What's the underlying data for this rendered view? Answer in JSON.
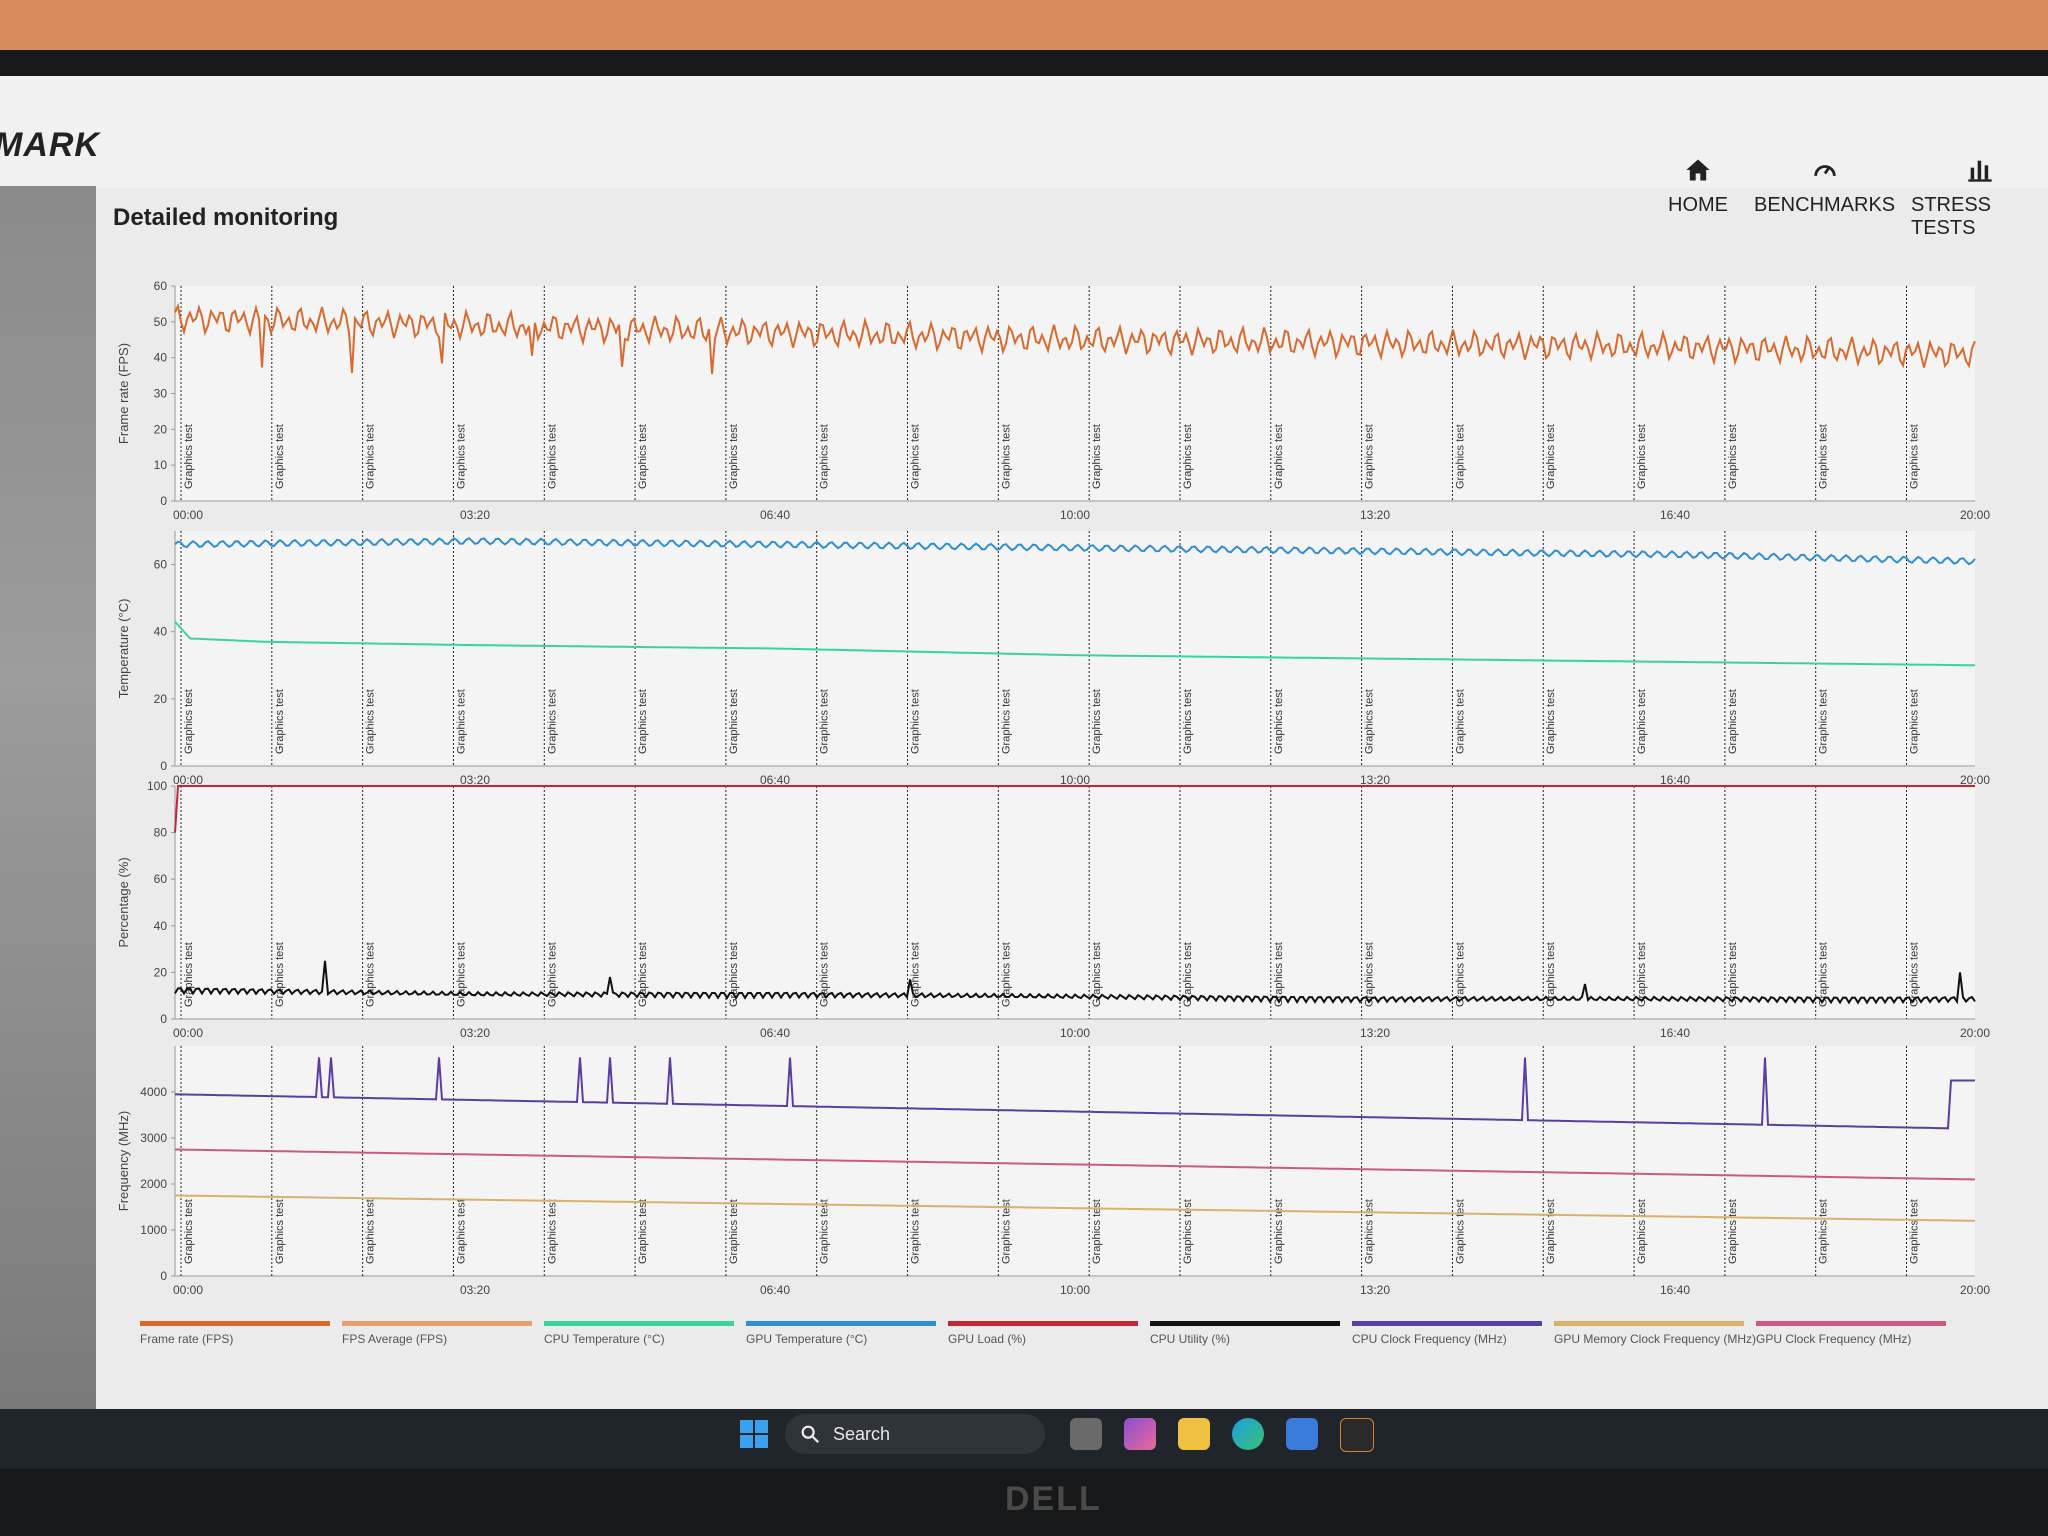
{
  "app": {
    "logo": "MARK"
  },
  "nav": [
    {
      "label": "HOME",
      "icon": "home-icon"
    },
    {
      "label": "BENCHMARKS",
      "icon": "gauge-icon"
    },
    {
      "label": "STRESS TESTS",
      "icon": "bar-chart-icon"
    }
  ],
  "page": {
    "title": "Detailed monitoring"
  },
  "taskbar": {
    "search_placeholder": "Search"
  },
  "monitor_brand": "DELL",
  "colors": {
    "frame_rate": "#d86a30",
    "fps_average": "#e5a070",
    "cpu_temp": "#3ad39a",
    "gpu_temp": "#2f8fd0",
    "gpu_load": "#c0283a",
    "cpu_utility": "#111111",
    "cpu_clock": "#5a3fa0",
    "gpu_mem_clock": "#d8b070",
    "gpu_clock": "#c85a86"
  },
  "chart_data": [
    {
      "type": "line",
      "ylabel": "Frame rate (FPS)",
      "ylim": [
        0,
        60
      ],
      "yticks": [
        0,
        10,
        20,
        30,
        40,
        50,
        60
      ],
      "x_ticks": [
        "00:00",
        "03:20",
        "06:40",
        "10:00",
        "13:20",
        "16:40",
        "20:00"
      ],
      "marker_label": "Graphics test",
      "series": [
        {
          "name": "Frame rate (FPS)",
          "x": [
            0,
            200,
            400,
            600,
            800,
            1000,
            1200
          ],
          "y": [
            51,
            49,
            47,
            45,
            44,
            43,
            41
          ]
        }
      ]
    },
    {
      "type": "line",
      "ylabel": "Temperature (°C)",
      "ylim": [
        0,
        70
      ],
      "yticks": [
        0,
        20,
        40,
        60
      ],
      "x_ticks": [
        "00:00",
        "03:20",
        "06:40",
        "10:00",
        "13:20",
        "16:40",
        "20:00"
      ],
      "marker_label": "Graphics test",
      "series": [
        {
          "name": "GPU Temperature (°C)",
          "x": [
            0,
            200,
            400,
            600,
            800,
            1000,
            1200
          ],
          "y": [
            66,
            67,
            66,
            65,
            64,
            63,
            61
          ]
        },
        {
          "name": "CPU Temperature (°C)",
          "x": [
            0,
            10,
            60,
            200,
            400,
            600,
            800,
            1000,
            1200
          ],
          "y": [
            43,
            38,
            37,
            36,
            35,
            33,
            32,
            31,
            30
          ]
        }
      ]
    },
    {
      "type": "line",
      "ylabel": "Percentage (%)",
      "ylim": [
        0,
        100
      ],
      "yticks": [
        0,
        20,
        40,
        60,
        80,
        100
      ],
      "x_ticks": [
        "00:00",
        "03:20",
        "06:40",
        "10:00",
        "13:20",
        "16:40",
        "20:00"
      ],
      "marker_label": "Graphics test",
      "series": [
        {
          "name": "GPU Load (%)",
          "x": [
            0,
            2,
            1200
          ],
          "y": [
            80,
            100,
            100
          ]
        },
        {
          "name": "CPU Utility (%)",
          "x": [
            0,
            200,
            400,
            600,
            800,
            1000,
            1200
          ],
          "y": [
            12,
            10,
            10,
            9,
            8,
            8,
            8
          ]
        }
      ]
    },
    {
      "type": "line",
      "ylabel": "Frequency (MHz)",
      "ylim": [
        0,
        5000
      ],
      "yticks": [
        0,
        1000,
        2000,
        3000,
        4000
      ],
      "x_ticks": [
        "00:00",
        "03:20",
        "06:40",
        "10:00",
        "13:20",
        "16:40",
        "20:00"
      ],
      "marker_label": "Graphics test",
      "series": [
        {
          "name": "CPU Clock Frequency (MHz)",
          "x": [
            0,
            1200
          ],
          "y": [
            3950,
            3950
          ]
        },
        {
          "name": "GPU Clock Frequency (MHz)",
          "x": [
            0,
            1200
          ],
          "y": [
            2750,
            2100
          ]
        },
        {
          "name": "GPU Memory Clock Frequency (MHz)",
          "x": [
            0,
            1200
          ],
          "y": [
            1750,
            1200
          ]
        }
      ]
    }
  ],
  "legend": [
    {
      "label": "Frame rate (FPS)",
      "color_key": "frame_rate"
    },
    {
      "label": "FPS Average (FPS)",
      "color_key": "fps_average"
    },
    {
      "label": "CPU Temperature (°C)",
      "color_key": "cpu_temp"
    },
    {
      "label": "GPU Temperature (°C)",
      "color_key": "gpu_temp"
    },
    {
      "label": "GPU Load (%)",
      "color_key": "gpu_load"
    },
    {
      "label": "CPU Utility (%)",
      "color_key": "cpu_utility"
    },
    {
      "label": "CPU Clock Frequency (MHz)",
      "color_key": "cpu_clock"
    },
    {
      "label": "GPU Memory Clock Frequency (MHz)",
      "color_key": "gpu_mem_clock"
    },
    {
      "label": "GPU Clock Frequency (MHz)",
      "color_key": "gpu_clock"
    }
  ]
}
